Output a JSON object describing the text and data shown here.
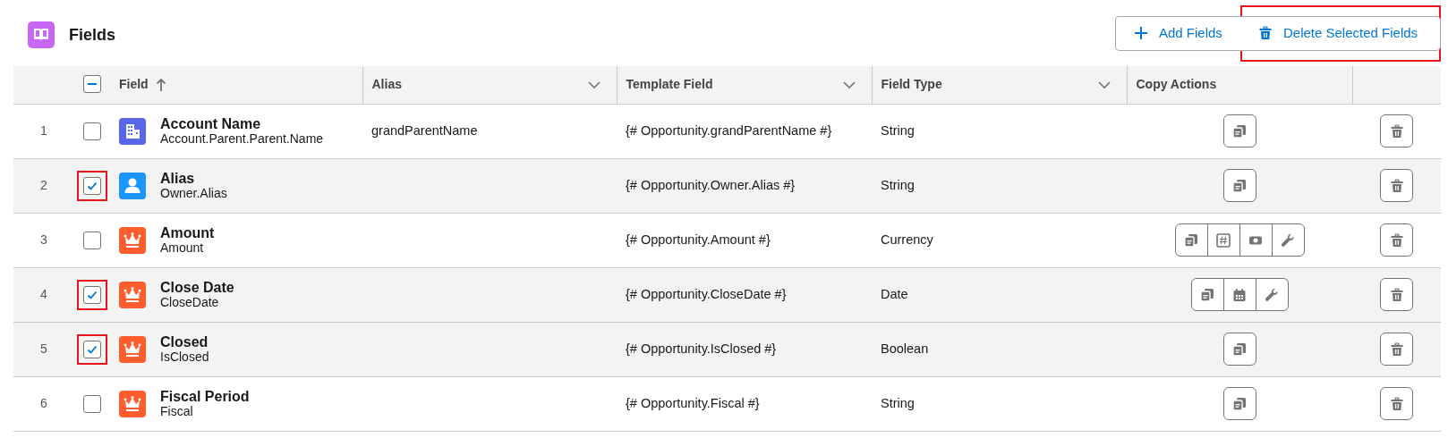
{
  "title": "Fields",
  "buttons": [
    {
      "label": "Add Fields",
      "kind": "add",
      "annotated": false
    },
    {
      "label": "Delete Selected Fields",
      "kind": "delete",
      "annotated": true
    }
  ],
  "table": {
    "header_checkbox": {
      "indeterminate": true
    },
    "columns": [
      {
        "label": "Field",
        "sorted": true,
        "menu": false
      },
      {
        "label": "Alias",
        "sorted": false,
        "menu": true
      },
      {
        "label": "Template Field",
        "sorted": false,
        "menu": true
      },
      {
        "label": "Field Type",
        "sorted": false,
        "menu": true
      },
      {
        "label": "Copy Actions",
        "sorted": false,
        "menu": false
      }
    ],
    "rows": [
      {
        "number": "1",
        "checked": false,
        "annotated": false,
        "kind": "account",
        "label": "Account Name",
        "api_name": "Account.Parent.Parent.Name",
        "alias": "grandParentName",
        "template_field": "{# Opportunity.grandParentName #}",
        "field_type": "String",
        "copy_actions": [
          {
            "kind": "copy"
          }
        ]
      },
      {
        "number": "2",
        "checked": true,
        "annotated": true,
        "kind": "user",
        "label": "Alias",
        "api_name": "Owner.Alias",
        "template_field": "{# Opportunity.Owner.Alias #}",
        "field_type": "String",
        "copy_actions": [
          {
            "kind": "copy"
          }
        ]
      },
      {
        "number": "3",
        "checked": false,
        "annotated": false,
        "kind": "opportunity",
        "label": "Amount",
        "api_name": "Amount",
        "template_field": "{# Opportunity.Amount #}",
        "field_type": "Currency",
        "copy_actions": [
          {
            "kind": "copy"
          },
          {
            "kind": "number"
          },
          {
            "kind": "money"
          },
          {
            "kind": "wrench"
          }
        ]
      },
      {
        "number": "4",
        "checked": true,
        "annotated": true,
        "kind": "opportunity",
        "label": "Close Date",
        "api_name": "CloseDate",
        "template_field": "{# Opportunity.CloseDate #}",
        "field_type": "Date",
        "copy_actions": [
          {
            "kind": "copy"
          },
          {
            "kind": "calendar"
          },
          {
            "kind": "wrench"
          }
        ]
      },
      {
        "number": "5",
        "checked": true,
        "annotated": true,
        "kind": "opportunity",
        "label": "Closed",
        "api_name": "IsClosed",
        "template_field": "{# Opportunity.IsClosed #}",
        "field_type": "Boolean",
        "copy_actions": [
          {
            "kind": "copy"
          }
        ]
      },
      {
        "number": "6",
        "checked": false,
        "annotated": false,
        "kind": "opportunity",
        "label": "Fiscal Period",
        "api_name": "Fiscal",
        "template_field": "{# Opportunity.Fiscal #}",
        "field_type": "String",
        "copy_actions": [
          {
            "kind": "copy"
          }
        ]
      }
    ]
  }
}
